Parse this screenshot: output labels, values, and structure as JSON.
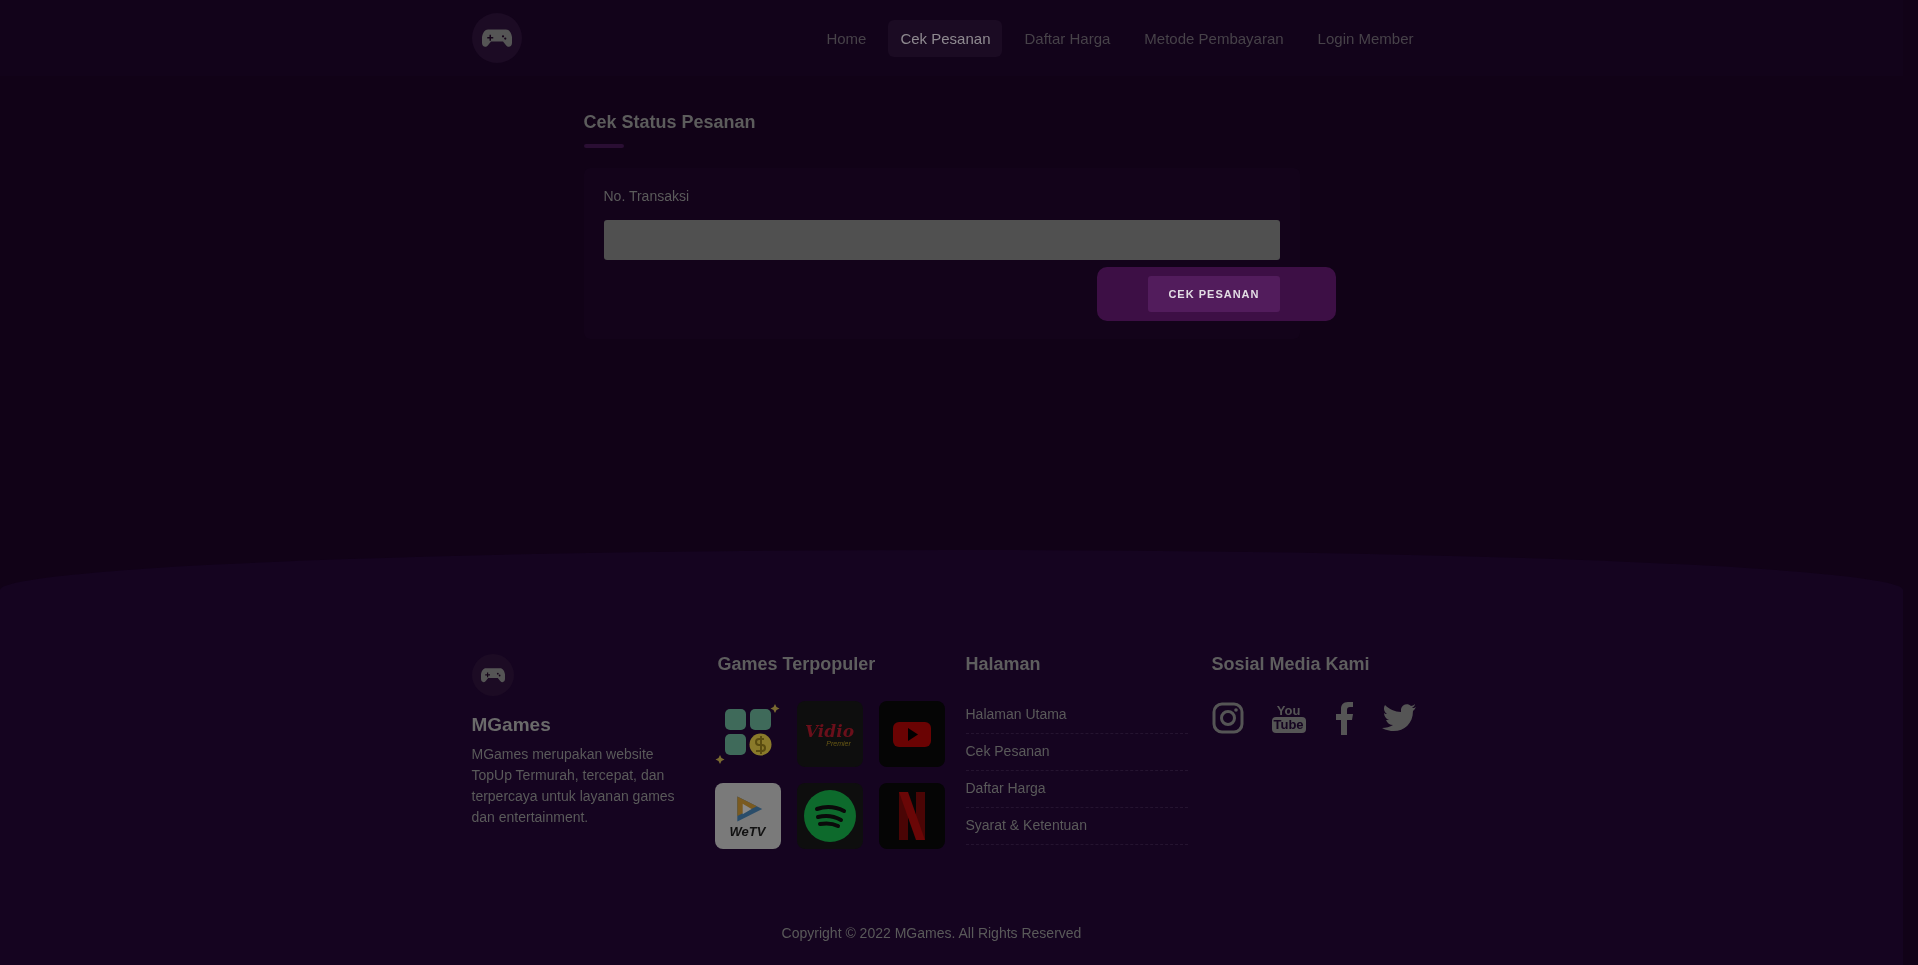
{
  "nav": {
    "items": [
      {
        "label": "Home",
        "selected": false
      },
      {
        "label": "Cek Pesanan",
        "selected": true
      },
      {
        "label": "Daftar Harga",
        "selected": false
      },
      {
        "label": "Metode Pembayaran",
        "selected": false
      },
      {
        "label": "Login Member",
        "selected": false
      }
    ]
  },
  "form": {
    "title": "Cek Status Pesanan",
    "field_label": "No. Transaksi",
    "button": "CEK PESANAN"
  },
  "footer": {
    "brand": "MGames",
    "description": "MGames merupakan website TopUp Termurah, tercepat, dan terpercaya untuk layanan games dan entertainment.",
    "games_title": "Games Terpopuler",
    "games": [
      {
        "kind": "coin"
      },
      {
        "kind": "vidio",
        "text": "Vidio",
        "subtext": "Premier"
      },
      {
        "kind": "youtube"
      },
      {
        "kind": "wetv",
        "text": "WeTV"
      },
      {
        "kind": "spotify"
      },
      {
        "kind": "netflix"
      }
    ],
    "pages_title": "Halaman",
    "pages": [
      "Halaman Utama",
      "Cek Pesanan",
      "Daftar Harga",
      "Syarat & Ketentuan"
    ],
    "social_title": "Sosial Media Kami",
    "social": [
      {
        "kind": "instagram"
      },
      {
        "kind": "youtube",
        "text": "You",
        "subtext": "Tube"
      },
      {
        "kind": "facebook"
      },
      {
        "kind": "twitter"
      }
    ],
    "copyright": "Copyright © 2022 MGames. All Rights Reserved"
  }
}
